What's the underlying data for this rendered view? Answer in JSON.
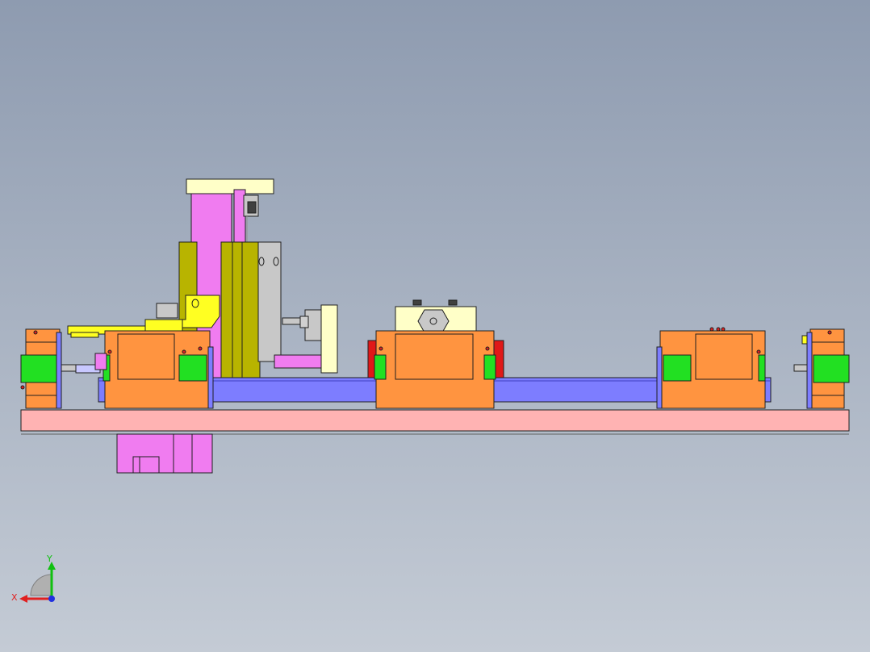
{
  "viewport": {
    "background_top": "#8e9bb0",
    "background_bottom": "#c4cbd5"
  },
  "colors": {
    "base_plate": "#ffb3b3",
    "rail": "#7d7dff",
    "slider": "#ff9440",
    "bearing_green": "#22e022",
    "cylinder_pink": "#f07cf0",
    "olive_plate": "#b8b400",
    "yellow_clamp": "#ffff22",
    "cream_block": "#ffffc8",
    "grey_cylinder": "#c8c8c8",
    "red_bracket": "#e01818",
    "outline": "#202020"
  },
  "triad": {
    "x_label": "X",
    "y_label": "Y",
    "x_color": "#e02020",
    "y_color": "#10c010",
    "z_color": "#2030e0"
  }
}
